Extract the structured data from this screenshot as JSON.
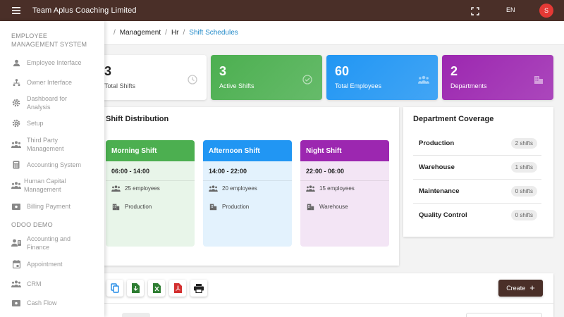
{
  "app": {
    "title": "Team Aplus Coaching Limited",
    "lang": "EN",
    "avatar_letter": "S"
  },
  "sidebar": {
    "section1": "EMPLOYEE MANAGEMENT SYSTEM",
    "items1": [
      {
        "label": "Employee Interface",
        "icon": "person-icon"
      },
      {
        "label": "Owner Interface",
        "icon": "org-icon"
      },
      {
        "label": "Dashboard for Analysis",
        "icon": "gear-icon"
      },
      {
        "label": "Setup",
        "icon": "gear-icon"
      },
      {
        "label": "Third Party Management",
        "icon": "people-icon"
      },
      {
        "label": "Accounting System",
        "icon": "calculator-icon"
      },
      {
        "label": "Human Capital Management",
        "icon": "people-icon"
      },
      {
        "label": "Billing Payment",
        "icon": "payment-icon"
      }
    ],
    "section2": "ODOO DEMO",
    "items2": [
      {
        "label": "Accounting and Finance",
        "icon": "contact-icon"
      },
      {
        "label": "Appointment",
        "icon": "calendar-icon"
      },
      {
        "label": "CRM",
        "icon": "people-icon"
      },
      {
        "label": "Cash Flow",
        "icon": "payment-icon"
      }
    ]
  },
  "breadcrumb": {
    "items": [
      "Management",
      "Hr"
    ],
    "current": "Shift Schedules"
  },
  "stats": [
    {
      "value": "3",
      "label": "Total Shifts"
    },
    {
      "value": "3",
      "label": "Active Shifts"
    },
    {
      "value": "60",
      "label": "Total Employees"
    },
    {
      "value": "2",
      "label": "Departments"
    }
  ],
  "distribution": {
    "title": "Shift Distribution",
    "shifts": [
      {
        "name": "Morning Shift",
        "time": "06:00 - 14:00",
        "employees": "25 employees",
        "department": "Production",
        "color": "#4caf50",
        "bg": "#e8f5e9"
      },
      {
        "name": "Afternoon Shift",
        "time": "14:00 - 22:00",
        "employees": "20 employees",
        "department": "Production",
        "color": "#2196f3",
        "bg": "#e3f2fd"
      },
      {
        "name": "Night Shift",
        "time": "22:00 - 06:00",
        "employees": "15 employees",
        "department": "Warehouse",
        "color": "#9c27b0",
        "bg": "#f3e5f5"
      }
    ]
  },
  "coverage": {
    "title": "Department Coverage",
    "rows": [
      {
        "name": "Production",
        "count": "2 shifts"
      },
      {
        "name": "Warehouse",
        "count": "1 shifts"
      },
      {
        "name": "Maintenance",
        "count": "0 shifts"
      },
      {
        "name": "Quality Control",
        "count": "0 shifts"
      }
    ]
  },
  "toolbar": {
    "create_label": "Create",
    "create_icon": "+"
  }
}
